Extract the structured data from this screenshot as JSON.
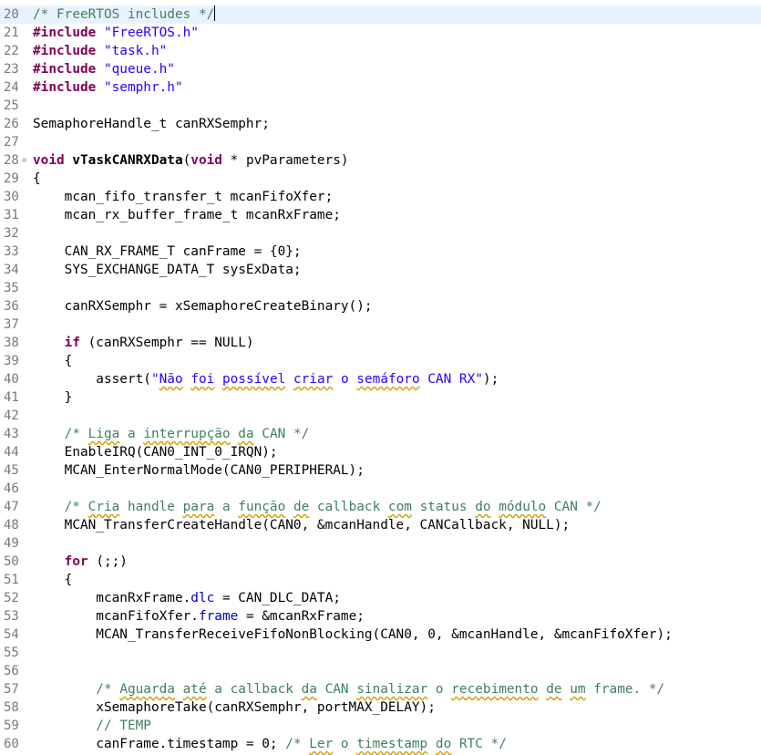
{
  "colors": {
    "keyword": "#7f0055",
    "string": "#2a00ff",
    "comment": "#3f7f5f",
    "field": "#0000c0",
    "line_number": "#787878",
    "current_line_background": "#e8f2fe",
    "spelling_underline": "#d4a000"
  },
  "editor": {
    "lines": [
      {
        "number": "20",
        "current": true,
        "tokens": [
          {
            "t": "comment",
            "v": "/* FreeRTOS includes */"
          },
          {
            "t": "caret",
            "v": ""
          }
        ]
      },
      {
        "number": "21",
        "tokens": [
          {
            "t": "keyword",
            "v": "#include"
          },
          {
            "t": "text",
            "v": " "
          },
          {
            "t": "string",
            "v": "\"FreeRTOS.h\""
          }
        ]
      },
      {
        "number": "22",
        "tokens": [
          {
            "t": "keyword",
            "v": "#include"
          },
          {
            "t": "text",
            "v": " "
          },
          {
            "t": "string",
            "v": "\"task.h\""
          }
        ]
      },
      {
        "number": "23",
        "tokens": [
          {
            "t": "keyword",
            "v": "#include"
          },
          {
            "t": "text",
            "v": " "
          },
          {
            "t": "string",
            "v": "\"queue.h\""
          }
        ]
      },
      {
        "number": "24",
        "tokens": [
          {
            "t": "keyword",
            "v": "#include"
          },
          {
            "t": "text",
            "v": " "
          },
          {
            "t": "string",
            "v": "\"semphr.h\""
          }
        ]
      },
      {
        "number": "25",
        "tokens": []
      },
      {
        "number": "26",
        "tokens": [
          {
            "t": "text",
            "v": "SemaphoreHandle_t canRXSemphr;"
          }
        ]
      },
      {
        "number": "27",
        "tokens": []
      },
      {
        "number": "28",
        "fold": true,
        "fold_icon": "⊖",
        "tokens": [
          {
            "t": "keyword",
            "v": "void"
          },
          {
            "t": "text",
            "v": " "
          },
          {
            "t": "func",
            "v": "vTaskCANRXData"
          },
          {
            "t": "text",
            "v": "("
          },
          {
            "t": "keyword",
            "v": "void"
          },
          {
            "t": "text",
            "v": " * pvParameters)"
          }
        ]
      },
      {
        "number": "29",
        "tokens": [
          {
            "t": "text",
            "v": "{"
          }
        ]
      },
      {
        "number": "30",
        "tokens": [
          {
            "t": "text",
            "v": "    mcan_fifo_transfer_t mcanFifoXfer;"
          }
        ]
      },
      {
        "number": "31",
        "tokens": [
          {
            "t": "text",
            "v": "    mcan_rx_buffer_frame_t mcanRxFrame;"
          }
        ]
      },
      {
        "number": "32",
        "tokens": []
      },
      {
        "number": "33",
        "tokens": [
          {
            "t": "text",
            "v": "    CAN_RX_FRAME_T canFrame = {0};"
          }
        ]
      },
      {
        "number": "34",
        "tokens": [
          {
            "t": "text",
            "v": "    SYS_EXCHANGE_DATA_T sysExData;"
          }
        ]
      },
      {
        "number": "35",
        "tokens": []
      },
      {
        "number": "36",
        "tokens": [
          {
            "t": "text",
            "v": "    canRXSemphr = xSemaphoreCreateBinary();"
          }
        ]
      },
      {
        "number": "37",
        "tokens": []
      },
      {
        "number": "38",
        "tokens": [
          {
            "t": "text",
            "v": "    "
          },
          {
            "t": "keyword",
            "v": "if"
          },
          {
            "t": "text",
            "v": " (canRXSemphr == NULL)"
          }
        ]
      },
      {
        "number": "39",
        "tokens": [
          {
            "t": "text",
            "v": "    {"
          }
        ]
      },
      {
        "number": "40",
        "tokens": [
          {
            "t": "text",
            "v": "        assert("
          },
          {
            "t": "string",
            "v": "\""
          },
          {
            "t": "string",
            "spell": true,
            "v": "Não"
          },
          {
            "t": "string",
            "v": " "
          },
          {
            "t": "string",
            "spell": true,
            "v": "foi"
          },
          {
            "t": "string",
            "v": " "
          },
          {
            "t": "string",
            "spell": true,
            "v": "possível"
          },
          {
            "t": "string",
            "v": " "
          },
          {
            "t": "string",
            "spell": true,
            "v": "criar"
          },
          {
            "t": "string",
            "v": " o "
          },
          {
            "t": "string",
            "spell": true,
            "v": "semáforo"
          },
          {
            "t": "string",
            "v": " CAN RX\""
          },
          {
            "t": "text",
            "v": ");"
          }
        ]
      },
      {
        "number": "41",
        "tokens": [
          {
            "t": "text",
            "v": "    }"
          }
        ]
      },
      {
        "number": "42",
        "tokens": []
      },
      {
        "number": "43",
        "tokens": [
          {
            "t": "comment",
            "v": "    /* "
          },
          {
            "t": "comment",
            "spell": true,
            "v": "Liga"
          },
          {
            "t": "comment",
            "v": " a "
          },
          {
            "t": "comment",
            "spell": true,
            "v": "interrupção"
          },
          {
            "t": "comment",
            "v": " "
          },
          {
            "t": "comment",
            "spell": true,
            "v": "da"
          },
          {
            "t": "comment",
            "v": " CAN */"
          }
        ]
      },
      {
        "number": "44",
        "tokens": [
          {
            "t": "text",
            "v": "    EnableIRQ(CAN0_INT_0_IRQN);"
          }
        ]
      },
      {
        "number": "45",
        "tokens": [
          {
            "t": "text",
            "v": "    MCAN_EnterNormalMode(CAN0_PERIPHERAL);"
          }
        ]
      },
      {
        "number": "46",
        "tokens": []
      },
      {
        "number": "47",
        "tokens": [
          {
            "t": "comment",
            "v": "    /* "
          },
          {
            "t": "comment",
            "spell": true,
            "v": "Cria"
          },
          {
            "t": "comment",
            "v": " handle "
          },
          {
            "t": "comment",
            "spell": true,
            "v": "para"
          },
          {
            "t": "comment",
            "v": " a "
          },
          {
            "t": "comment",
            "spell": true,
            "v": "função"
          },
          {
            "t": "comment",
            "v": " "
          },
          {
            "t": "comment",
            "spell": true,
            "v": "de"
          },
          {
            "t": "comment",
            "v": " callback "
          },
          {
            "t": "comment",
            "spell": true,
            "v": "com"
          },
          {
            "t": "comment",
            "v": " status "
          },
          {
            "t": "comment",
            "spell": true,
            "v": "do"
          },
          {
            "t": "comment",
            "v": " "
          },
          {
            "t": "comment",
            "spell": true,
            "v": "módulo"
          },
          {
            "t": "comment",
            "v": " CAN */"
          }
        ]
      },
      {
        "number": "48",
        "tokens": [
          {
            "t": "text",
            "v": "    MCAN_TransferCreateHandle(CAN0, &mcanHandle, CANCallback, NULL);"
          }
        ]
      },
      {
        "number": "49",
        "tokens": []
      },
      {
        "number": "50",
        "tokens": [
          {
            "t": "text",
            "v": "    "
          },
          {
            "t": "keyword",
            "v": "for"
          },
          {
            "t": "text",
            "v": " (;;)"
          }
        ]
      },
      {
        "number": "51",
        "tokens": [
          {
            "t": "text",
            "v": "    {"
          }
        ]
      },
      {
        "number": "52",
        "tokens": [
          {
            "t": "text",
            "v": "        mcanRxFrame."
          },
          {
            "t": "field",
            "v": "dlc"
          },
          {
            "t": "text",
            "v": " = CAN_DLC_DATA;"
          }
        ]
      },
      {
        "number": "53",
        "tokens": [
          {
            "t": "text",
            "v": "        mcanFifoXfer."
          },
          {
            "t": "field",
            "v": "frame"
          },
          {
            "t": "text",
            "v": " = &mcanRxFrame;"
          }
        ]
      },
      {
        "number": "54",
        "tokens": [
          {
            "t": "text",
            "v": "        MCAN_TransferReceiveFifoNonBlocking(CAN0, 0, &mcanHandle, &mcanFifoXfer);"
          }
        ]
      },
      {
        "number": "55",
        "tokens": []
      },
      {
        "number": "56",
        "tokens": []
      },
      {
        "number": "57",
        "tokens": [
          {
            "t": "comment",
            "v": "        /* "
          },
          {
            "t": "comment",
            "spell": true,
            "v": "Aguarda"
          },
          {
            "t": "comment",
            "v": " "
          },
          {
            "t": "comment",
            "spell": true,
            "v": "até"
          },
          {
            "t": "comment",
            "v": " a callback "
          },
          {
            "t": "comment",
            "spell": true,
            "v": "da"
          },
          {
            "t": "comment",
            "v": " CAN "
          },
          {
            "t": "comment",
            "spell": true,
            "v": "sinalizar"
          },
          {
            "t": "comment",
            "v": " o "
          },
          {
            "t": "comment",
            "spell": true,
            "v": "recebimento"
          },
          {
            "t": "comment",
            "v": " "
          },
          {
            "t": "comment",
            "spell": true,
            "v": "de"
          },
          {
            "t": "comment",
            "v": " "
          },
          {
            "t": "comment",
            "spell": true,
            "v": "um"
          },
          {
            "t": "comment",
            "v": " frame. */"
          }
        ]
      },
      {
        "number": "58",
        "tokens": [
          {
            "t": "text",
            "v": "        xSemaphoreTake(canRXSemphr, portMAX_DELAY);"
          }
        ]
      },
      {
        "number": "59",
        "tokens": [
          {
            "t": "comment",
            "v": "        // TEMP"
          }
        ]
      },
      {
        "number": "60",
        "tokens": [
          {
            "t": "text",
            "v": "        canFrame.timestamp = 0; "
          },
          {
            "t": "comment",
            "v": "/* "
          },
          {
            "t": "comment",
            "spell": true,
            "v": "Ler"
          },
          {
            "t": "comment",
            "v": " o "
          },
          {
            "t": "comment",
            "spell": true,
            "v": "timestamp"
          },
          {
            "t": "comment",
            "v": " "
          },
          {
            "t": "comment",
            "spell": true,
            "v": "do"
          },
          {
            "t": "comment",
            "v": " RTC */"
          }
        ]
      }
    ]
  }
}
